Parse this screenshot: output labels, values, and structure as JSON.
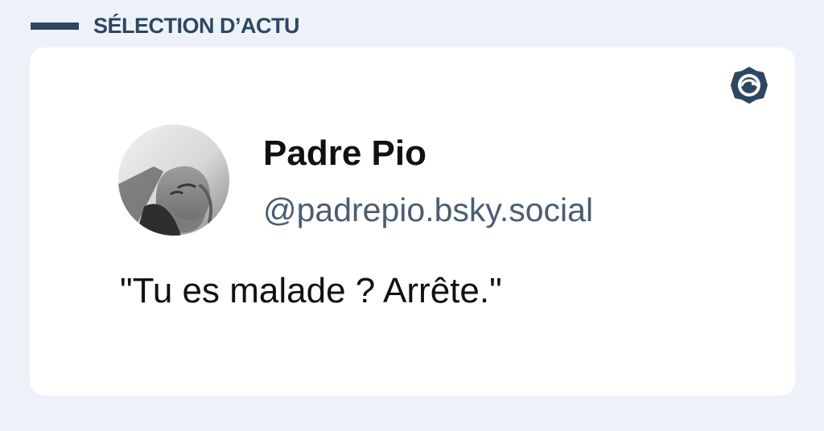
{
  "header": {
    "section_label": "SÉLECTION D’ACTU"
  },
  "post": {
    "author_name": "Padre Pio",
    "author_handle": "@padrepio.bsky.social",
    "text": "\"Tu es malade ? Arrête.\"",
    "avatar_icon": "user-avatar-photo",
    "brand_icon": "bluesky-logo-badge-icon"
  },
  "colors": {
    "page_background": "#edf2f8",
    "accent": "#2d4762",
    "card_background": "#ffffff",
    "handle_text": "#4a5d72",
    "primary_text": "#111111"
  }
}
